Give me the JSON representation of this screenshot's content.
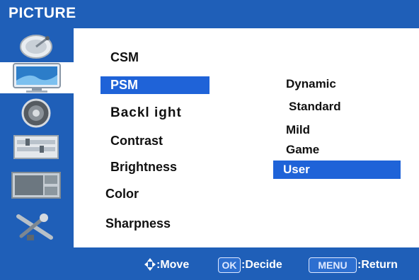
{
  "title": "PICTURE",
  "sidebar": {
    "items": [
      {
        "icon": "satellite-dish-icon"
      },
      {
        "icon": "tv-monitor-icon",
        "selected": true
      },
      {
        "icon": "speaker-icon"
      },
      {
        "icon": "settings-panel-icon"
      },
      {
        "icon": "pip-display-icon"
      },
      {
        "icon": "tools-icon"
      }
    ]
  },
  "menu": {
    "items": [
      {
        "label": "CSM"
      },
      {
        "label": "PSM",
        "selected": true
      },
      {
        "label": "Backl ight"
      },
      {
        "label": "Contrast"
      },
      {
        "label": "Brightness"
      },
      {
        "label": "Color"
      },
      {
        "label": "Sharpness"
      }
    ]
  },
  "options": {
    "items": [
      {
        "label": "Dynamic"
      },
      {
        "label": "Standard"
      },
      {
        "label": "Mild"
      },
      {
        "label": "Game"
      },
      {
        "label": "User",
        "selected": true
      }
    ]
  },
  "footer": {
    "move_label": ":Move",
    "ok_key": "OK",
    "decide_label": ":Decide",
    "menu_key": "MENU",
    "return_label": ":Return"
  },
  "colors": {
    "frame_blue": "#1f5fb8",
    "highlight_blue": "#1f63d8",
    "panel_white": "#ffffff"
  }
}
